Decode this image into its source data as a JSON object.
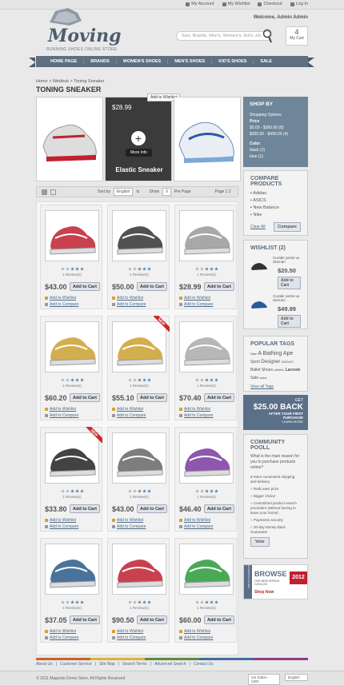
{
  "top_links": [
    "My Account",
    "My Wishlist",
    "Checkout",
    "Log In"
  ],
  "welcome": "Welcome, Admin Admin",
  "logo": {
    "title": "Moving",
    "subtitle": "RUNNING SHOES ONLINE STORE"
  },
  "search": {
    "placeholder": "Size, Brands, Men's, Women's, Kid's, etc."
  },
  "cart": {
    "count": "4",
    "label": "My Cart"
  },
  "nav": [
    "HOME PAGE",
    "BRANDS",
    "WOMEN'S SHOES",
    "MEN'S SHOES",
    "KID'S SHOES",
    "SALE"
  ],
  "breadcrumb": "Home > Webbuk > Toning Sneaker",
  "page_title": "TONING SNEAKER",
  "featured": {
    "price": "$28.99",
    "more": "More info",
    "name": "Elastic Sneaker",
    "wishlist_tip": "Add to Wishlist"
  },
  "shopby": {
    "title": "SHOP BY",
    "subtitle": "Shopping Options",
    "price_label": "Price",
    "price1": "$0.00 - $300.00 (8)",
    "price2": "$300.00 - $400.00 (4)",
    "color_label": "Color",
    "color1": "black (2)",
    "color2": "blue (1)"
  },
  "compare": {
    "title": "COMPARE PRODUCTS",
    "items": [
      "Adidas",
      "ASICS",
      "New Balance",
      "Nike"
    ],
    "clear": "Clear All",
    "button": "Compare"
  },
  "wishlist": {
    "title": "WISHLIST (2)",
    "items": [
      {
        "name": "Curabir pente ue siteman",
        "price": "$20.50"
      },
      {
        "name": "Curabir pente ue sitemen",
        "price": "$49.99"
      }
    ],
    "add": "Add to Cart"
  },
  "tags": {
    "title": "POPULAR TAGS",
    "list": [
      "Nike",
      "A Bathing Ape",
      "Sport",
      "Designer",
      "ADIDAS",
      "Ballet",
      "Shoes",
      "athletic",
      "Lacoste",
      "Sale",
      "asics"
    ],
    "view": "View all Tags"
  },
  "promo": {
    "get": "GET",
    "amount": "$25.00 BACK",
    "text": "AFTER YOUR FIRST PURCHASE",
    "learn": "LEARN MORE"
  },
  "poll": {
    "title": "COMMUNITY POOLL",
    "question": "What is the main reason for you to purchase products online?",
    "options": [
      "More convenient shipping and delivery",
      "RedLower price",
      "Bigger choice",
      "Centralized product search procedure (without having to leave your home)",
      "Payments security",
      "30-day Money Back Guarantee"
    ],
    "vote": "Vote"
  },
  "browse": {
    "title": "BROWSE",
    "sub": "OUR NEW SPRING CATALOG",
    "shop": "Shop Now",
    "year": "2012",
    "side": "FOR STYLE MAGAZINES"
  },
  "toolbar": {
    "sortby": "Sort by",
    "sort_value": "English",
    "show": "Show",
    "show_value": "9",
    "perpage": "Per Page",
    "page": "Page 1 2"
  },
  "products": [
    {
      "price": "$43.00",
      "reviews": "1 Review(s)",
      "new": false,
      "color": "#c02030"
    },
    {
      "price": "$50.00",
      "reviews": "1 Review(s)",
      "new": false,
      "color": "#333333"
    },
    {
      "price": "$28.99",
      "reviews": "1 Review(s)",
      "new": false,
      "color": "#999999"
    },
    {
      "price": "$60.20",
      "reviews": "1 Review(s)",
      "new": false,
      "color": "#caa030"
    },
    {
      "price": "$55.10",
      "reviews": "1 Review(s)",
      "new": true,
      "color": "#caa030"
    },
    {
      "price": "$70.40",
      "reviews": "1 Review(s)",
      "new": false,
      "color": "#aaaaaa"
    },
    {
      "price": "$33.80",
      "reviews": "1 Review(s)",
      "new": true,
      "color": "#222222"
    },
    {
      "price": "$43.00",
      "reviews": "1 Review(s)",
      "new": false,
      "color": "#666666"
    },
    {
      "price": "$46.40",
      "reviews": "1 Review(s)",
      "new": false,
      "color": "#7a3aa0"
    },
    {
      "price": "$37.05",
      "reviews": "1 Review(s)",
      "new": false,
      "color": "#2a5a8a"
    },
    {
      "price": "$90.50",
      "reviews": "1 Review(s)",
      "new": false,
      "color": "#c02030"
    },
    {
      "price": "$60.00",
      "reviews": "1 Review(s)",
      "new": false,
      "color": "#2a9a3a"
    }
  ],
  "product_labels": {
    "add_to_cart": "Add to Cart",
    "wishlist": "Add to Wishlist",
    "compare": "Add to Compare",
    "new": "NEW"
  },
  "footer": {
    "links": [
      "About Us",
      "|",
      "Customer Service",
      "|",
      "Site Map",
      "|",
      "Search Terms",
      "|",
      "Advanced Search",
      "|",
      "Contact Us"
    ],
    "copyright": "© 2011 Magento Demo Store. All Rights Reserved",
    "currency": "US Dollar - USD",
    "language": "English"
  }
}
